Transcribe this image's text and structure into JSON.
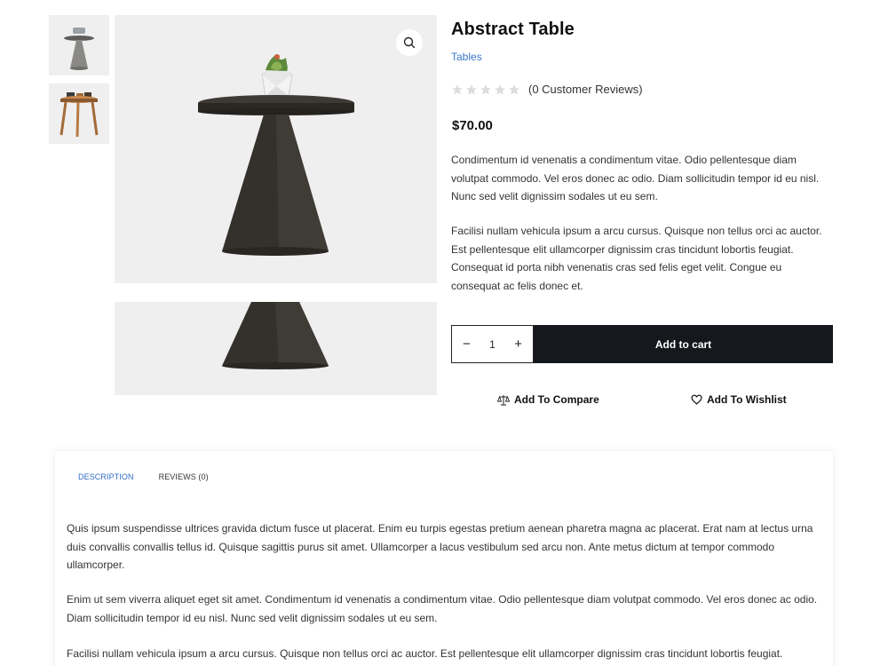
{
  "product": {
    "title": "Abstract Table",
    "category": "Tables",
    "rating_text": "(0 Customer Reviews)",
    "rating_value": 0,
    "rating_max": 5,
    "price": "$70.00",
    "description": [
      "Condimentum id venenatis a condimentum vitae. Odio pellentesque diam volutpat commodo. Vel eros donec ac odio. Diam sollicitudin tempor id eu nisl. Nunc sed velit dignissim sodales ut eu sem.",
      "Facilisi nullam vehicula ipsum a arcu cursus. Quisque non tellus orci ac auctor. Est pellentesque elit ullamcorper dignissim cras tincidunt lobortis feugiat. Consequat id porta nibh venenatis cras sed felis eget velit. Congue eu consequat ac felis donec et."
    ]
  },
  "gallery": {
    "thumbnails": [
      "side-table-black",
      "side-table-wood"
    ],
    "zoom_icon": "search-icon"
  },
  "cart": {
    "quantity": "1",
    "minus": "−",
    "plus": "+",
    "add_to_cart": "Add to cart"
  },
  "actions": {
    "compare": "Add To Compare",
    "wishlist": "Add To Wishlist"
  },
  "tabs": {
    "items": [
      {
        "label": "DESCRIPTION",
        "active": true
      },
      {
        "label": "REVIEWS (0)",
        "active": false
      }
    ],
    "content": [
      "Quis ipsum suspendisse ultrices gravida dictum fusce ut placerat. Enim eu turpis egestas pretium aenean pharetra magna ac placerat. Erat nam at lectus urna duis convallis convallis tellus id. Quisque sagittis purus sit amet. Ullamcorper a lacus vestibulum sed arcu non. Ante metus dictum at tempor commodo ullamcorper.",
      "Enim ut sem viverra aliquet eget sit amet. Condimentum id venenatis a condimentum vitae. Odio pellentesque diam volutpat commodo. Vel eros donec ac odio. Diam sollicitudin tempor id eu nisl. Nunc sed velit dignissim sodales ut eu sem.",
      "Facilisi nullam vehicula ipsum a arcu cursus. Quisque non tellus orci ac auctor. Est pellentesque elit ullamcorper dignissim cras tincidunt lobortis feugiat."
    ]
  },
  "colors": {
    "accent": "#2e6bc2",
    "button_dark": "#15191d",
    "star_empty": "#dcdcdc"
  }
}
